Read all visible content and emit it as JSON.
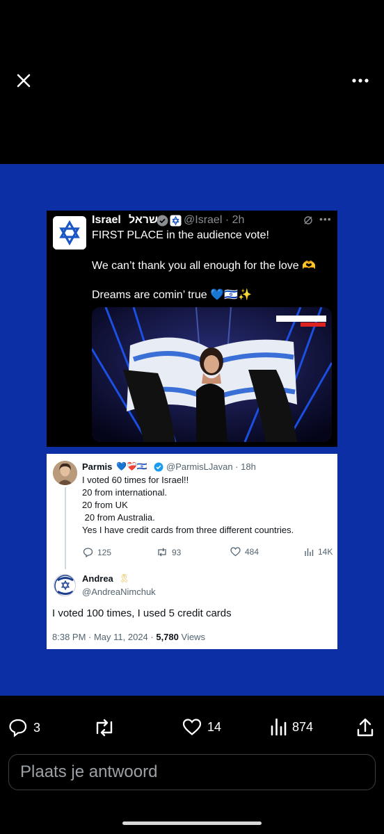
{
  "viewer": {
    "close_icon": "close-icon",
    "more_icon": "more-horizontal-icon"
  },
  "tweet1": {
    "name": "Israel",
    "name_hebrew": "ישראל",
    "handle": "@Israel",
    "time": "2h",
    "lines": [
      "FIRST PLACE in the audience vote!",
      "We can’t thank you all enough for the love 🫶",
      "Dreams are comin’ true 💙🇮🇱✨"
    ],
    "photo_caption": "כאן|11 שידור חי"
  },
  "tweet2": {
    "name": "Parmis",
    "name_emoji": "💙❤️‍🩹🇮🇱",
    "handle": "@ParmisLJavan",
    "time": "18h",
    "lines": [
      "I voted 60 times for Israel!!",
      "20 from international.",
      "20 from UK",
      " 20 from Australia.",
      "Yes I have credit cards from three different countries."
    ],
    "stats": {
      "replies": "125",
      "reposts": "93",
      "likes": "484",
      "views": "14K"
    }
  },
  "reply": {
    "name": "Andrea",
    "ribbon": "🎗",
    "handle": "@AndreaNimchuk",
    "avatar_text": "I STAND WITH ISRAEL",
    "body": "I voted 100 times, I used 5 credit cards",
    "timestamp": "8:38 PM · May 11, 2024 · ",
    "views_count": "5,780",
    "views_label": " Views"
  },
  "actions": {
    "replies": "3",
    "likes": "14",
    "views": "874"
  },
  "compose": {
    "placeholder": "Plaats je antwoord"
  },
  "colors": {
    "media_background": "#0c2fa6",
    "verified_badge": "#1d9bf0"
  }
}
